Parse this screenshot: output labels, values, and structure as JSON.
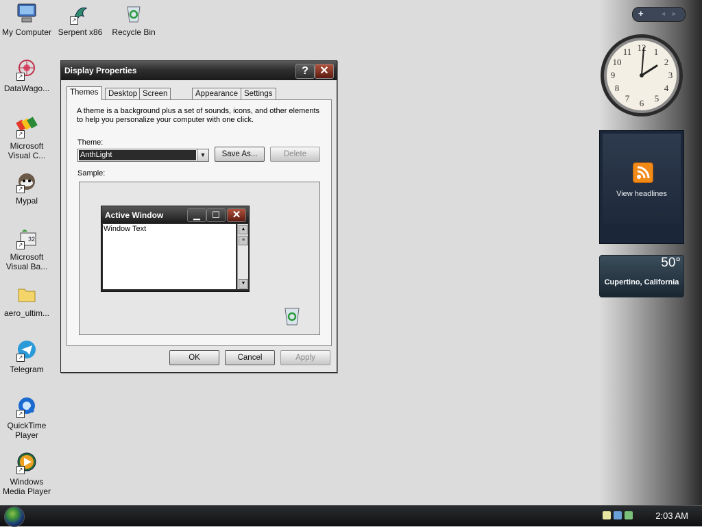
{
  "desktop": {
    "icons": [
      {
        "label": "My Computer",
        "icon": "computer-icon"
      },
      {
        "label": "Serpent x86",
        "icon": "serpent-icon"
      },
      {
        "label": "Recycle Bin",
        "icon": "recycle-bin-icon"
      },
      {
        "label": "DataWago...",
        "icon": "datawago-icon"
      },
      {
        "label": "Microsoft Visual C...",
        "icon": "visual-c-icon"
      },
      {
        "label": "Mypal",
        "icon": "mypal-icon"
      },
      {
        "label": "Microsoft Visual Ba...",
        "icon": "visual-basic-icon"
      },
      {
        "label": "aero_ultim...",
        "icon": "folder-icon"
      },
      {
        "label": "Telegram",
        "icon": "telegram-icon"
      },
      {
        "label": "QuickTime Player",
        "icon": "quicktime-icon"
      },
      {
        "label": "Windows Media Player",
        "icon": "media-player-icon"
      }
    ]
  },
  "sidebar": {
    "add_label": "+",
    "prev_label": "◄",
    "next_label": "►",
    "rss_label": "View headlines",
    "weather_temp": "50°",
    "weather_city": "Cupertino, California"
  },
  "dialog": {
    "title": "Display Properties",
    "help_label": "?",
    "close_label": "✕",
    "tabs": [
      "Themes",
      "Desktop",
      "Screen Saver",
      "Appearance",
      "Settings"
    ],
    "description": "A theme is a background plus a set of sounds, icons, and other elements to help you personalize your computer with one click.",
    "theme_label": "Theme:",
    "theme_value": "AnthLight",
    "save_as_label": "Save As...",
    "delete_label": "Delete",
    "sample_label": "Sample:",
    "sample_window": {
      "title": "Active Window",
      "text": "Window Text",
      "minimize": "▁",
      "maximize": "☐",
      "close": "✕"
    },
    "ok_label": "OK",
    "cancel_label": "Cancel",
    "apply_label": "Apply"
  },
  "taskbar": {
    "clock": "2:03 AM"
  },
  "colors": {
    "titlebar": "#1a1a1a",
    "close_button": "#8e2f1e",
    "rss_orange": "#f28a18"
  }
}
